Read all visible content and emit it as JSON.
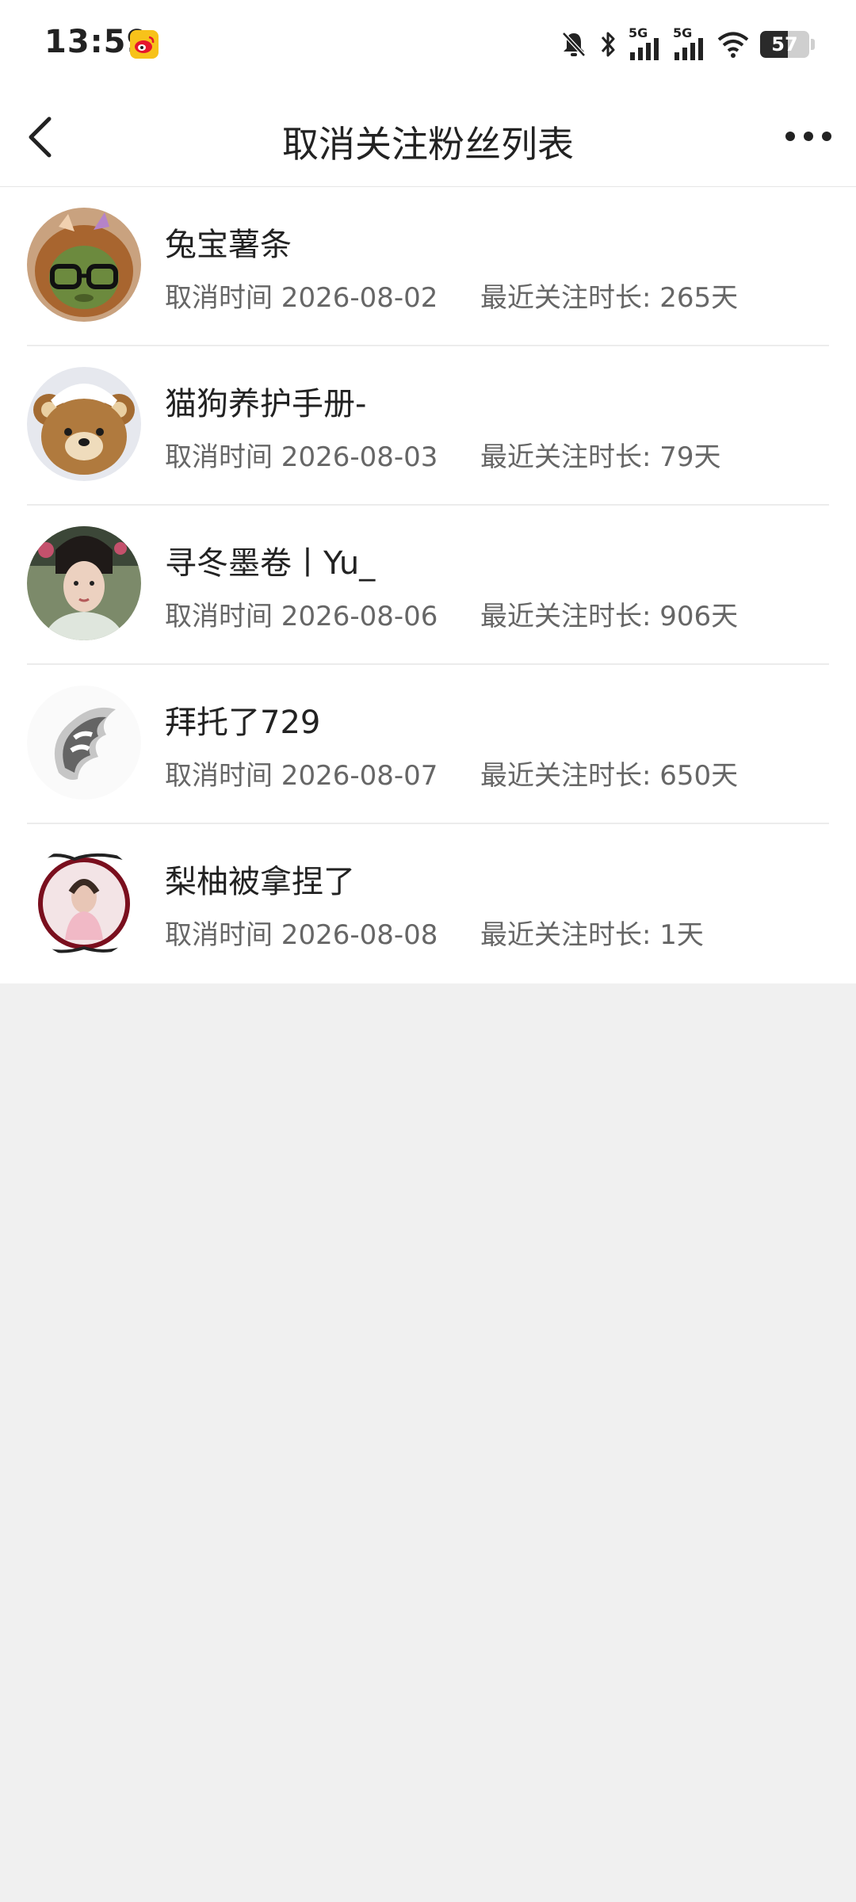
{
  "status_bar": {
    "time": "13:59",
    "battery": "57",
    "battery_level": 0.57,
    "network_1": "5G",
    "network_2": "5G"
  },
  "nav": {
    "title": "取消关注粉丝列表"
  },
  "list": [
    {
      "name": "兔宝薯条",
      "unfollow_time": "取消时间 2026-08-02",
      "follow_duration": "最近关注时长: 265天",
      "avatar": "avatar-glasses-plush"
    },
    {
      "name": "猫狗养护手册-",
      "unfollow_time": "取消时间 2026-08-03",
      "follow_duration": "最近关注时长: 79天",
      "avatar": "avatar-teddy-bear"
    },
    {
      "name": "寻冬墨卷丨Yu_",
      "unfollow_time": "取消时间 2026-08-06",
      "follow_duration": "最近关注时长: 906天",
      "avatar": "avatar-portrait"
    },
    {
      "name": "拜托了729",
      "unfollow_time": "取消时间 2026-08-07",
      "follow_duration": "最近关注时长: 650天",
      "avatar": "avatar-blur-sketch"
    },
    {
      "name": "梨柚被拿捏了",
      "unfollow_time": "取消时间 2026-08-08",
      "follow_duration": "最近关注时长: 1天",
      "avatar": "avatar-framed-photo"
    }
  ]
}
